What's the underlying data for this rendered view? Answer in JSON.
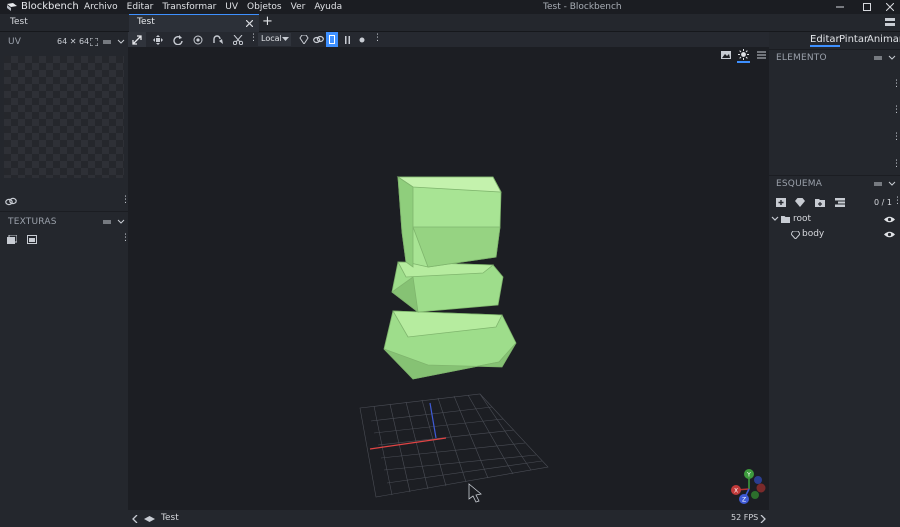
{
  "app": {
    "name": "Blockbench",
    "window_title": "Test - Blockbench"
  },
  "menu": [
    "Archivo",
    "Editar",
    "Transformar",
    "UV",
    "Objetos",
    "Ver",
    "Ayuda"
  ],
  "window_controls": [
    "minimize-icon",
    "maximize-icon",
    "close-icon"
  ],
  "tabs": {
    "left_tab": "Test",
    "active_tab": "Test",
    "new_tab": "+"
  },
  "uv_panel": {
    "title": "UV",
    "size": "64 ✕ 64"
  },
  "textures_panel": {
    "title": "TEXTURAS"
  },
  "toolbar": {
    "space_select": "Local"
  },
  "modes": [
    "Editar",
    "Pintar",
    "Animar"
  ],
  "active_mode": "Editar",
  "element_panel": {
    "title": "ELEMENTO"
  },
  "outliner": {
    "title": "ESQUEMA",
    "count": "0 / 1",
    "items": [
      {
        "label": "root",
        "type": "folder"
      },
      {
        "label": "body",
        "type": "cube"
      }
    ]
  },
  "status": {
    "project": "Test",
    "fps": "52 FPS"
  },
  "gizmo": {
    "x_label": "X",
    "y_label": "Y",
    "z_label": "Z"
  },
  "colors": {
    "accent": "#3e90ff",
    "model": "#9edd8b",
    "viewport_bg": "#1c1e23"
  }
}
